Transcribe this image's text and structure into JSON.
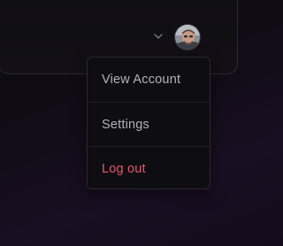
{
  "header": {
    "dropdown_icon": "chevron-down-icon",
    "avatar_icon": "user-avatar"
  },
  "menu": {
    "items": [
      {
        "label": "View Account"
      },
      {
        "label": "Settings"
      },
      {
        "label": "Log out",
        "color": "#e8576a"
      }
    ]
  }
}
